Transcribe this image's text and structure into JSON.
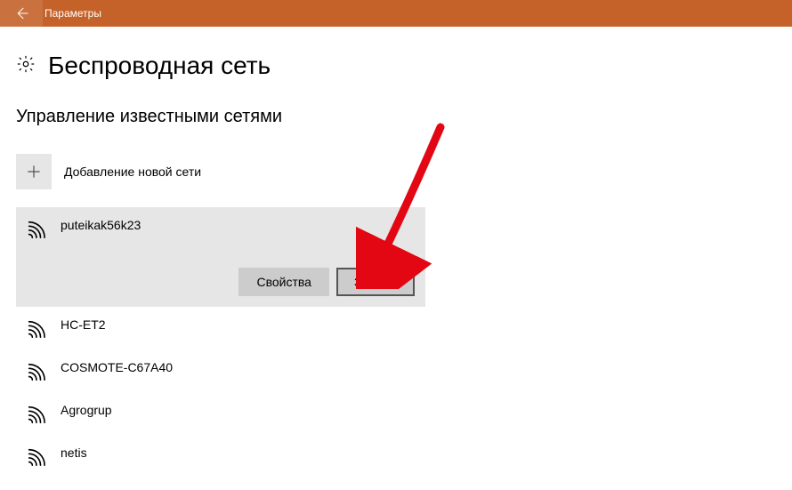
{
  "titlebar": {
    "title": "Параметры"
  },
  "page": {
    "heading": "Беспроводная сеть",
    "subheading": "Управление известными сетями",
    "add_label": "Добавление новой сети"
  },
  "networks": [
    {
      "name": "puteikak56k23",
      "selected": true
    },
    {
      "name": "HC-ET2",
      "selected": false
    },
    {
      "name": "COSMOTE-C67A40",
      "selected": false
    },
    {
      "name": "Agrogrup",
      "selected": false
    },
    {
      "name": "netis",
      "selected": false
    }
  ],
  "actions": {
    "properties": "Свойства",
    "forget": "Забыть"
  }
}
